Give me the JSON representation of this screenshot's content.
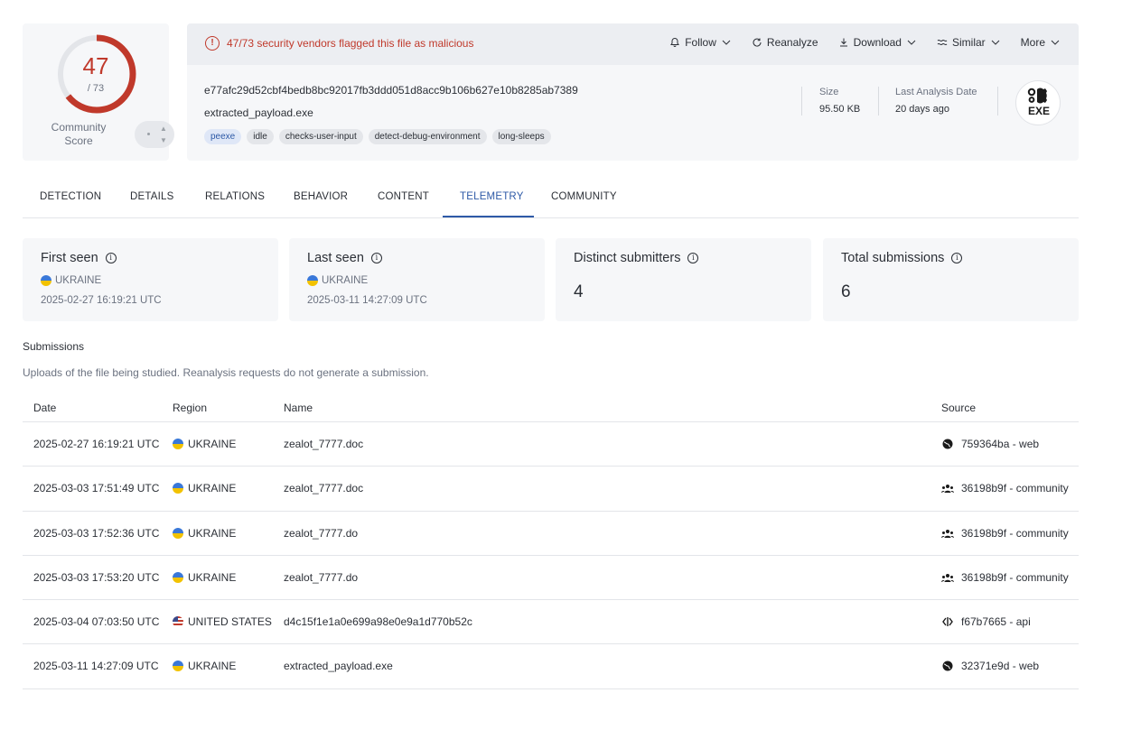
{
  "score": {
    "detected": "47",
    "total": "/ 73",
    "community_label": "Community Score"
  },
  "alert": {
    "text": "47/73 security vendors flagged this file as malicious"
  },
  "actions": [
    {
      "label": "Follow",
      "icon": "bell-icon"
    },
    {
      "label": "Reanalyze",
      "icon": "refresh-icon"
    },
    {
      "label": "Download",
      "icon": "download-icon"
    },
    {
      "label": "Similar",
      "icon": "similar-icon"
    },
    {
      "label": "More",
      "icon": ""
    }
  ],
  "file": {
    "hash": "e77afc29d52cbf4bedb8bc92017fb3ddd051d8acc9b106b627e10b8285ab7389",
    "name": "extracted_payload.exe",
    "tags": [
      "peexe",
      "idle",
      "checks-user-input",
      "detect-debug-environment",
      "long-sleeps"
    ],
    "size_label": "Size",
    "size_value": "95.50 KB",
    "last_analysis_label": "Last Analysis Date",
    "last_analysis_value": "20 days ago",
    "type_badge": "EXE"
  },
  "tabs": [
    "DETECTION",
    "DETAILS",
    "RELATIONS",
    "BEHAVIOR",
    "CONTENT",
    "TELEMETRY",
    "COMMUNITY"
  ],
  "active_tab": "TELEMETRY",
  "stats": {
    "first_seen": {
      "title": "First seen",
      "region": "UKRAINE",
      "time": "2025-02-27 16:19:21 UTC"
    },
    "last_seen": {
      "title": "Last seen",
      "region": "UKRAINE",
      "time": "2025-03-11 14:27:09 UTC"
    },
    "distinct": {
      "title": "Distinct submitters",
      "value": "4"
    },
    "total": {
      "title": "Total submissions",
      "value": "6"
    }
  },
  "submissions": {
    "title": "Submissions",
    "description": "Uploads of the file being studied. Reanalysis requests do not generate a submission.",
    "headers": {
      "date": "Date",
      "region": "Region",
      "name": "Name",
      "source": "Source"
    },
    "rows": [
      {
        "date": "2025-02-27 16:19:21 UTC",
        "region": "UKRAINE",
        "flag": "ua",
        "name": "zealot_7777.doc",
        "source": "759364ba - web",
        "source_icon": "globe-icon"
      },
      {
        "date": "2025-03-03 17:51:49 UTC",
        "region": "UKRAINE",
        "flag": "ua",
        "name": "zealot_7777.doc",
        "source": "36198b9f - community",
        "source_icon": "community-icon"
      },
      {
        "date": "2025-03-03 17:52:36 UTC",
        "region": "UKRAINE",
        "flag": "ua",
        "name": "zealot_7777.do",
        "source": "36198b9f - community",
        "source_icon": "community-icon"
      },
      {
        "date": "2025-03-03 17:53:20 UTC",
        "region": "UKRAINE",
        "flag": "ua",
        "name": "zealot_7777.do",
        "source": "36198b9f - community",
        "source_icon": "community-icon"
      },
      {
        "date": "2025-03-04 07:03:50 UTC",
        "region": "UNITED STATES",
        "flag": "us",
        "name": "d4c15f1e1a0e699a98e0e9a1d770b52c",
        "source": "f67b7665 - api",
        "source_icon": "api-icon"
      },
      {
        "date": "2025-03-11 14:27:09 UTC",
        "region": "UKRAINE",
        "flag": "ua",
        "name": "extracted_payload.exe",
        "source": "32371e9d - web",
        "source_icon": "globe-icon"
      }
    ]
  },
  "colors": {
    "malicious": "#c0392b",
    "accent": "#2e5aa7",
    "card_bg": "#f6f7f9"
  }
}
